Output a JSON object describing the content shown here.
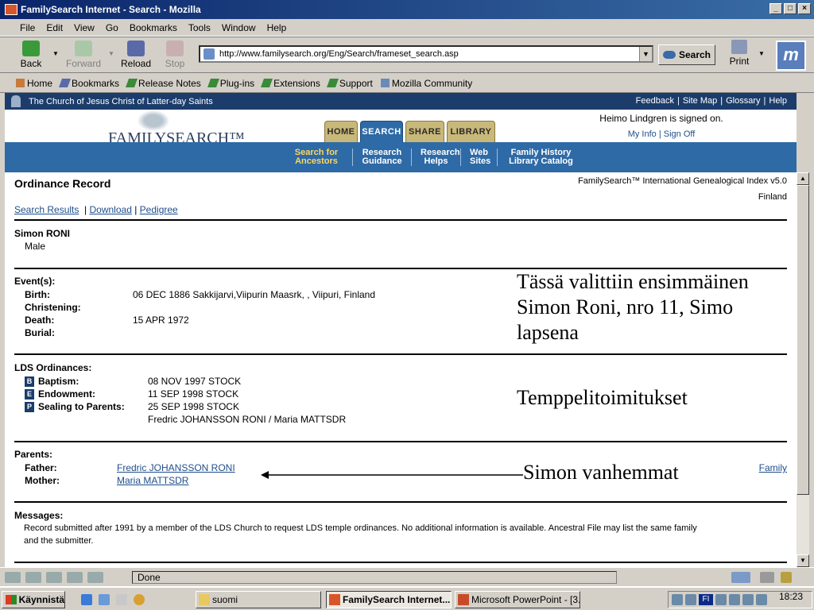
{
  "window": {
    "title": "FamilySearch Internet - Search - Mozilla"
  },
  "menu": [
    "File",
    "Edit",
    "View",
    "Go",
    "Bookmarks",
    "Tools",
    "Window",
    "Help"
  ],
  "nav": {
    "back": "Back",
    "forward": "Forward",
    "reload": "Reload",
    "stop": "Stop",
    "url": "http://www.familysearch.org/Eng/Search/frameset_search.asp",
    "search": "Search",
    "print": "Print"
  },
  "personal_bar": [
    "Home",
    "Bookmarks",
    "Release Notes",
    "Plug-ins",
    "Extensions",
    "Support",
    "Mozilla Community"
  ],
  "site": {
    "church": "The Church of Jesus Christ of Latter-day Saints",
    "top_links": [
      "Feedback",
      "Site Map",
      "Glossary",
      "Help"
    ],
    "logo": "FAMILYSEARCH™",
    "tabs": [
      "HOME",
      "SEARCH",
      "SHARE",
      "LIBRARY"
    ],
    "signed_in": "Heimo Lindgren is signed on.",
    "my_info": "My Info",
    "sign_off": "Sign Off",
    "nav": [
      "Search for Ancestors",
      "Research Guidance",
      "Research Helps",
      "Web Sites",
      "Family History Library Catalog"
    ]
  },
  "record": {
    "heading": "Ordinance Record",
    "source": "FamilySearch™ International Genealogical Index v5.0",
    "region": "Finland",
    "links": [
      "Search Results",
      "Download",
      "Pedigree"
    ],
    "name": "Simon RONI",
    "sex": "Male",
    "events_label": "Event(s):",
    "birth_label": "Birth:",
    "birth": "06 DEC 1886  Sakkijarvi,Viipurin Maasrk, , Viipuri, Finland",
    "christening_label": "Christening:",
    "death_label": "Death:",
    "death": "15 APR 1972",
    "burial_label": "Burial:",
    "ordinances_label": "LDS Ordinances:",
    "baptism_label": "Baptism:",
    "baptism": "08 NOV 1997  STOCK",
    "endowment_label": "Endowment:",
    "endowment": "11 SEP 1998  STOCK",
    "sealing_label": "Sealing to Parents:",
    "sealing": "25 SEP 1998  STOCK",
    "sealing_parents": "Fredric JOHANSSON RONI / Maria MATTSDR",
    "badge_b": "B",
    "badge_e": "E",
    "badge_p": "P",
    "parents_label": "Parents:",
    "father_label": "Father:",
    "father": "Fredric JOHANSSON RONI",
    "mother_label": "Mother:",
    "mother": "Maria MATTSDR",
    "family_link": "Family",
    "messages_label": "Messages:",
    "message_1": "Record submitted after 1991 by a member of the LDS Church to request LDS temple ordinances. No additional information is available. Ancestral File may list the same family",
    "message_2": "and the submitter."
  },
  "annotations": {
    "a1_l1": "Tässä valittiin ensimmäinen",
    "a1_l2": "Simon Roni, nro 11, Simo",
    "a1_l3": "lapsena",
    "a2": "Temppelitoimitukset",
    "a3": "Simon vanhemmat"
  },
  "status": {
    "text": "Done"
  },
  "taskbar": {
    "start": "Käynnistä",
    "tasks": [
      "suomi",
      "FamilySearch Internet...",
      "Microsoft PowerPoint - [3..."
    ],
    "lang": "FI",
    "clock": "18:23"
  }
}
